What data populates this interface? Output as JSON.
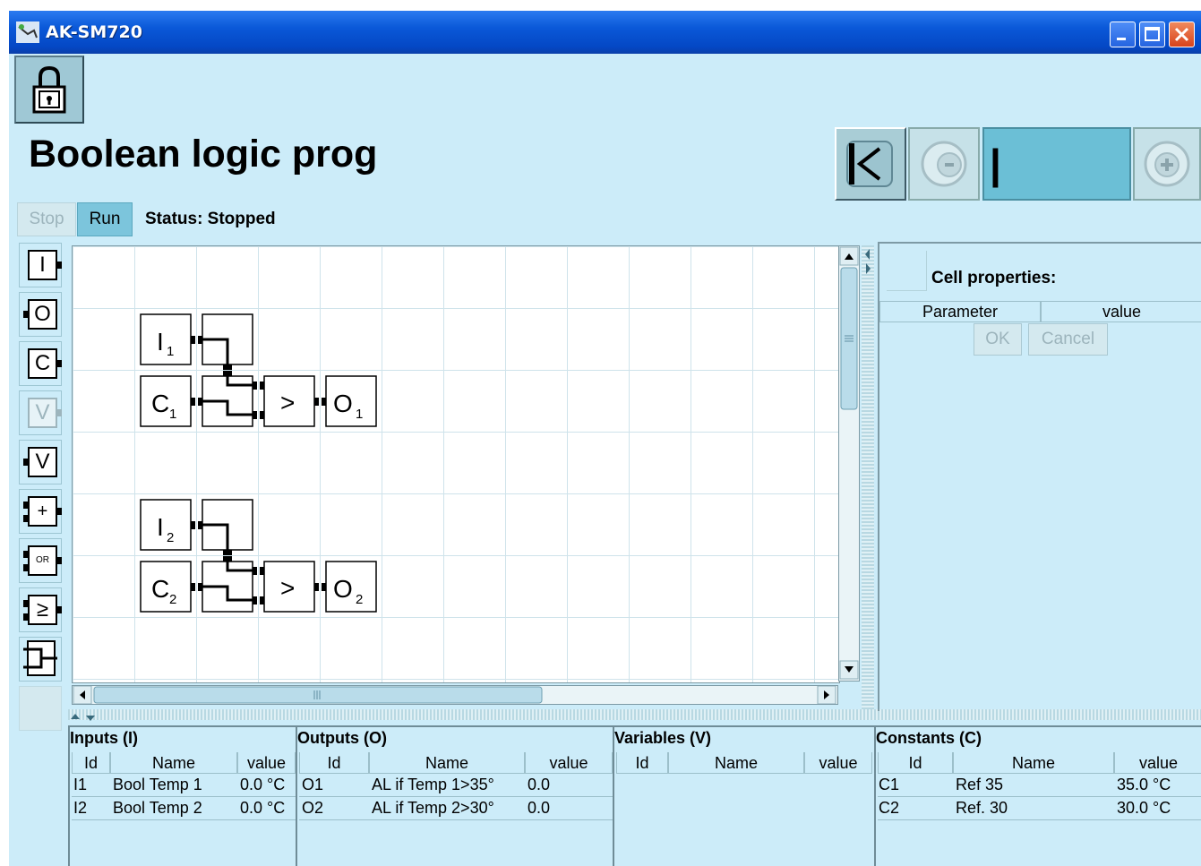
{
  "window": {
    "title": "AK-SM720"
  },
  "page": {
    "title": "Boolean logic prog"
  },
  "controls": {
    "stop_label": "Stop",
    "run_label": "Run",
    "status_text": "Status: Stopped"
  },
  "navigation": {
    "first_icon": "first-page-icon",
    "prev_icon": "minus-icon",
    "next_icon": "plus-icon",
    "field_value": "|"
  },
  "palette": [
    {
      "label": "I",
      "name": "input-block-tool",
      "enabled": true
    },
    {
      "label": "O",
      "name": "output-block-tool",
      "enabled": true
    },
    {
      "label": "C",
      "name": "constant-block-tool",
      "enabled": true
    },
    {
      "label": "V",
      "name": "variable-read-tool",
      "enabled": false
    },
    {
      "label": "V",
      "name": "variable-write-tool",
      "enabled": true
    },
    {
      "label": "+",
      "name": "add-block-tool",
      "enabled": true
    },
    {
      "label": "OR",
      "name": "or-block-tool",
      "enabled": true
    },
    {
      "label": "≥",
      "name": "compare-block-tool",
      "enabled": true
    },
    {
      "label": "",
      "name": "connector-tool",
      "enabled": true
    }
  ],
  "diagram": {
    "blocks": {
      "i1": "I",
      "i1_sub": "1",
      "c1": "C",
      "c1_sub": "1",
      "gt1": ">",
      "o1": "O",
      "o1_sub": "1",
      "i2": "I",
      "i2_sub": "2",
      "c2": "C",
      "c2_sub": "2",
      "gt2": ">",
      "o2": "O",
      "o2_sub": "2"
    }
  },
  "cell_properties": {
    "title": "Cell properties:",
    "columns": [
      "Parameter",
      "value"
    ],
    "ok_label": "OK",
    "cancel_label": "Cancel"
  },
  "inputs": {
    "title": "Inputs (I)",
    "columns": [
      "Id",
      "Name",
      "value"
    ],
    "rows": [
      {
        "id": "I1",
        "name": "Bool Temp 1",
        "value": "0.0 °C"
      },
      {
        "id": "I2",
        "name": "Bool Temp 2",
        "value": "0.0 °C"
      }
    ]
  },
  "outputs": {
    "title": "Outputs (O)",
    "columns": [
      "Id",
      "Name",
      "value"
    ],
    "rows": [
      {
        "id": "O1",
        "name": "AL if Temp 1>35°",
        "value": "0.0"
      },
      {
        "id": "O2",
        "name": "AL if Temp 2>30°",
        "value": "0.0"
      }
    ]
  },
  "variables": {
    "title": "Variables (V)",
    "columns": [
      "Id",
      "Name",
      "value"
    ],
    "rows": []
  },
  "constants": {
    "title": "Constants (C)",
    "columns": [
      "Id",
      "Name",
      "value"
    ],
    "rows": [
      {
        "id": "C1",
        "name": "Ref 35",
        "value": "35.0 °C"
      },
      {
        "id": "C2",
        "name": "Ref. 30",
        "value": "30.0 °C"
      }
    ]
  }
}
